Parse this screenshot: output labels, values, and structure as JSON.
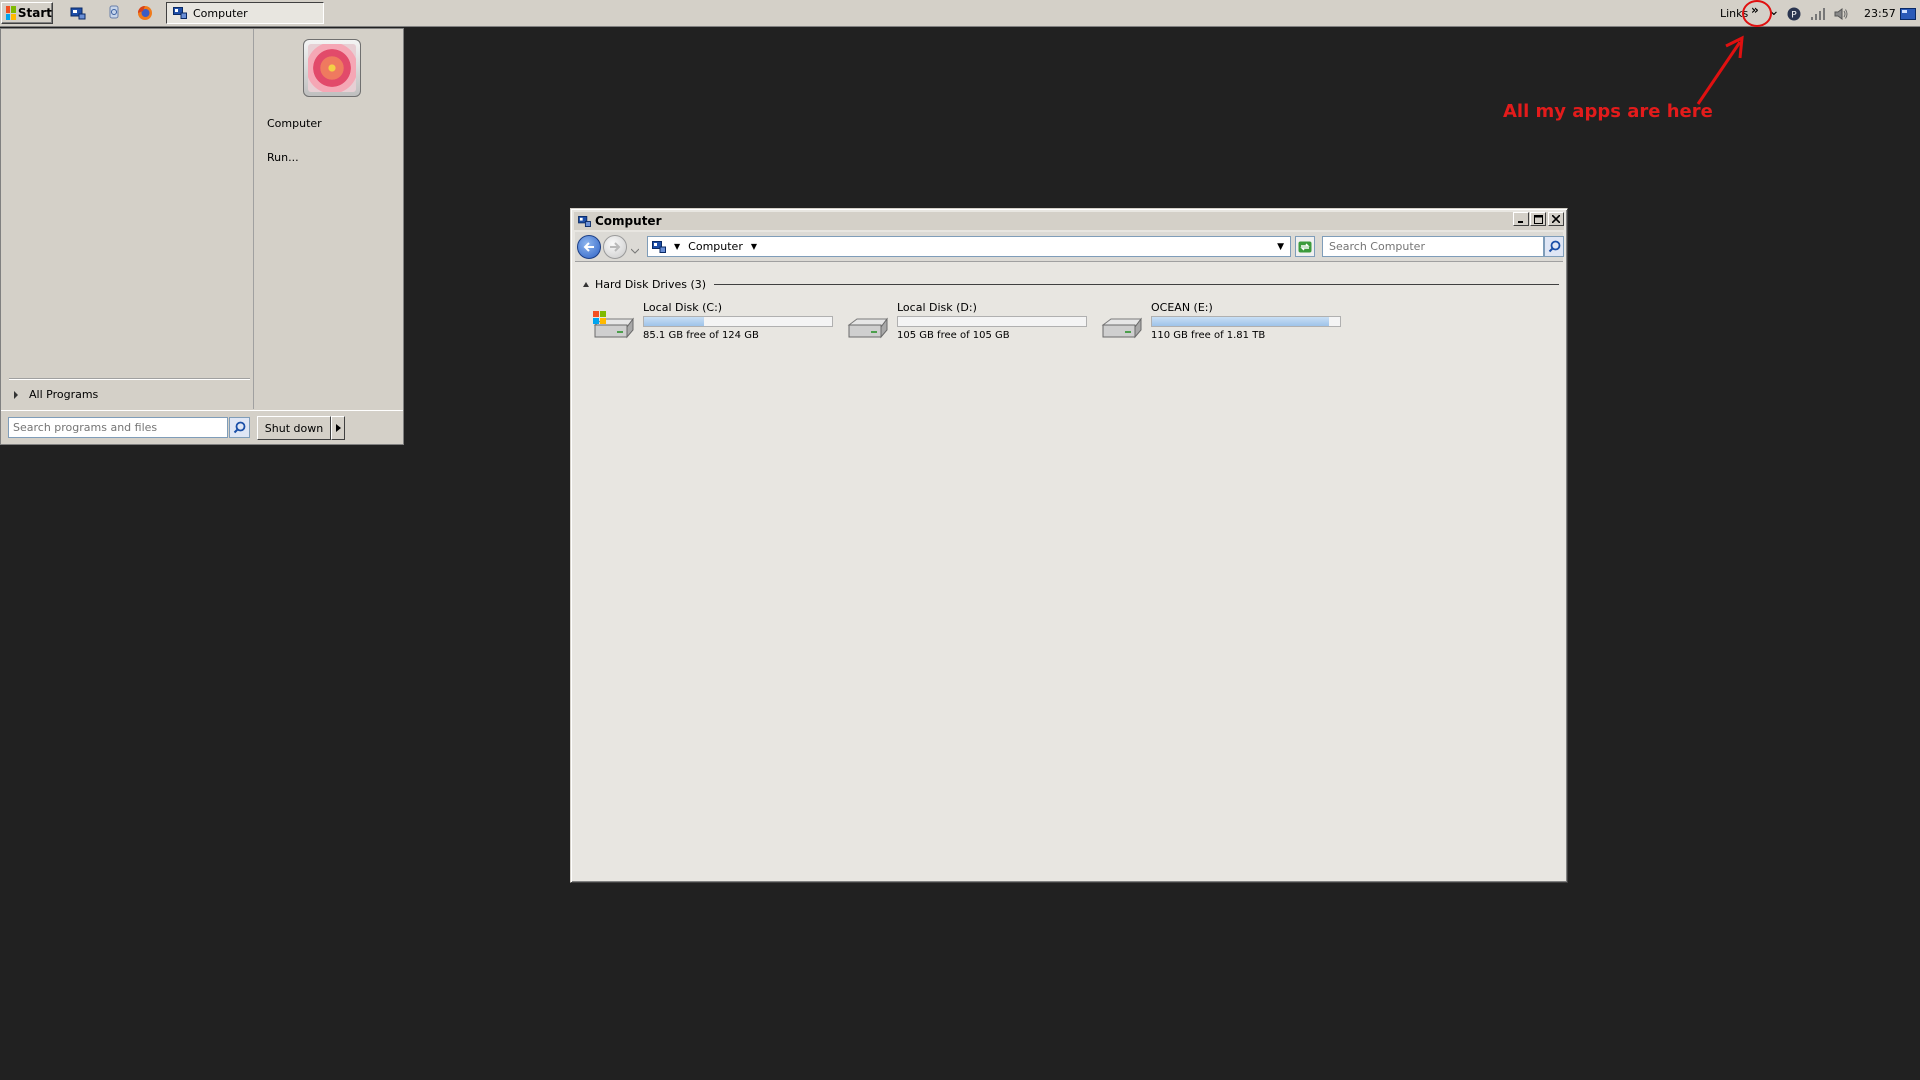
{
  "taskbar": {
    "start_label": "Start",
    "task_computer_label": "Computer",
    "links_label": "Links",
    "overflow_chevron": "»",
    "tray_expand": "⌄",
    "clock": "23:57"
  },
  "annotation": {
    "text": "All my apps are here",
    "color": "#e31b1b"
  },
  "start_menu": {
    "right_items": [
      "Computer",
      "Run..."
    ],
    "all_programs_label": "All Programs",
    "search_placeholder": "Search programs and files",
    "shutdown_label": "Shut down"
  },
  "explorer": {
    "title": "Computer",
    "address_segment": "Computer",
    "search_placeholder": "Search Computer",
    "group_label": "Hard Disk Drives (3)",
    "drives": [
      {
        "name": "Local Disk (C:)",
        "free_text": "85.1 GB free of 124 GB",
        "used_fraction": 0.32,
        "icon": "windows-drive-icon"
      },
      {
        "name": "Local Disk (D:)",
        "free_text": "105 GB free of 105 GB",
        "used_fraction": 0.0,
        "icon": "hard-drive-icon"
      },
      {
        "name": "OCEAN (E:)",
        "free_text": "110 GB free of 1.81 TB",
        "used_fraction": 0.94,
        "icon": "hard-drive-icon"
      }
    ]
  }
}
